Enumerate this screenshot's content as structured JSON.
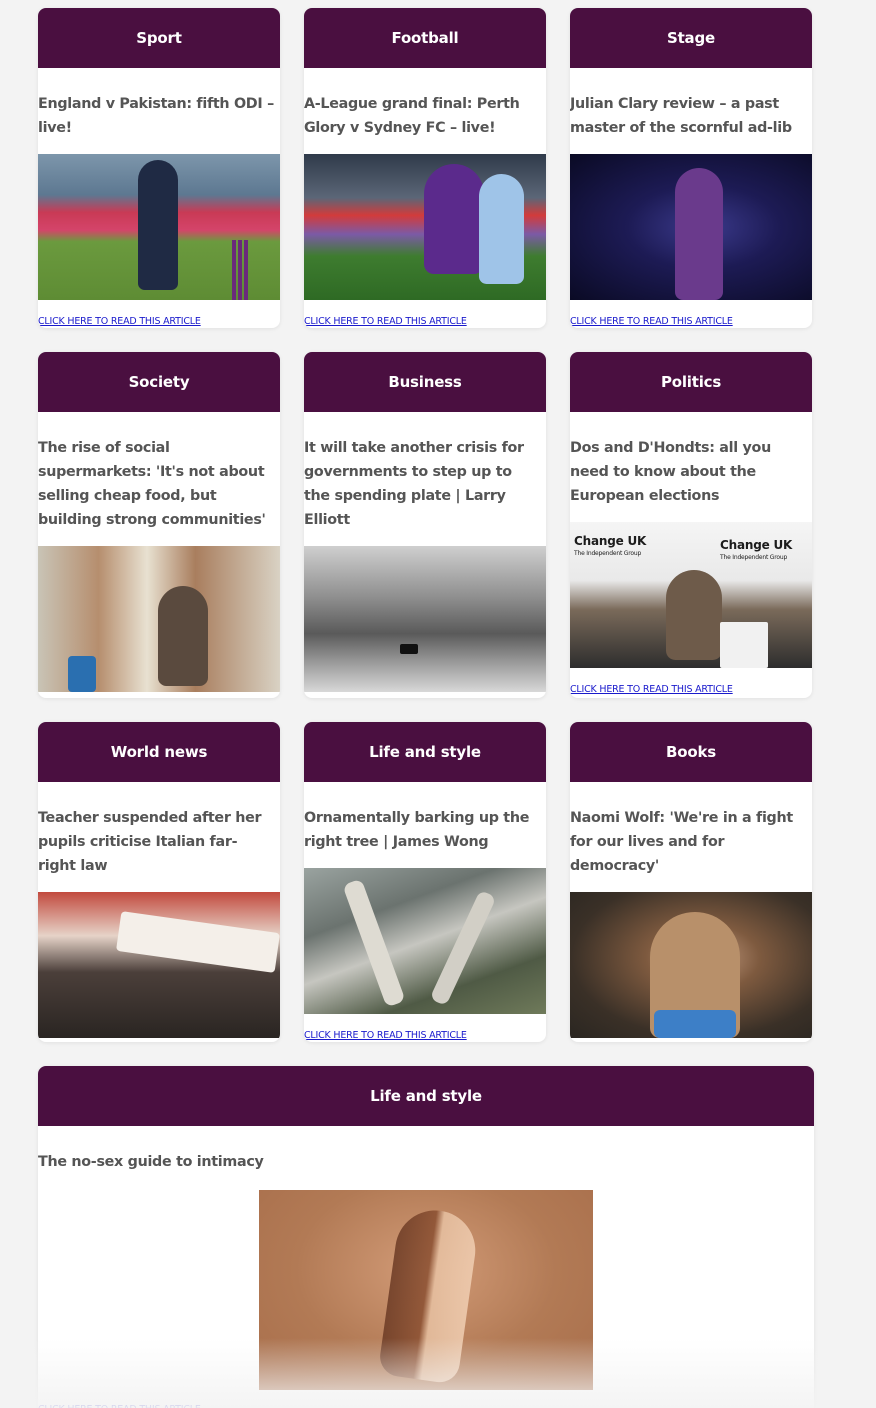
{
  "colors": {
    "header_bg": "#4a0f40",
    "header_text": "#ffffff",
    "title_text": "#555555",
    "link_text": "#1a1acc",
    "page_bg": "#f3f3f3"
  },
  "link_text": "CLICK HERE TO READ THIS ARTICLE",
  "cards": [
    {
      "category": "Sport",
      "title": "England v Pakistan: fifth ODI – live!",
      "image": "cricket-batsman-image"
    },
    {
      "category": "Football",
      "title": "A-League grand final: Perth Glory v Sydney FC – live!",
      "image": "football-players-image"
    },
    {
      "category": "Stage",
      "title": "Julian Clary review – a past master of the scornful ad-lib",
      "image": "stage-performer-image"
    },
    {
      "category": "Society",
      "title": "The rise of social supermarkets: 'It's not about selling cheap food, but building strong communities'",
      "image": "supermarket-aisle-image"
    },
    {
      "category": "Business",
      "title": "It will take another crisis for governments to step up to the spending plate | Larry Elliott",
      "image": "dust-storm-image"
    },
    {
      "category": "Politics",
      "title": "Dos and D'Hondts: all you need to know about the European elections",
      "image": "politician-podium-image",
      "overlay_left": "Change UK",
      "overlay_left_sub": "The Independent Group",
      "overlay_right": "Change UK",
      "overlay_right_sub": "The Independent Group"
    },
    {
      "category": "World news",
      "title": "Teacher suspended after her pupils criticise Italian far-right law",
      "image": "protest-crowd-image"
    },
    {
      "category": "Life and style",
      "title": "Ornamentally barking up the right tree | James Wong",
      "image": "gnarled-trees-image"
    },
    {
      "category": "Books",
      "title": "Naomi Wolf: 'We're in a fight for our lives and for democracy'",
      "image": "portrait-woman-image"
    },
    {
      "category": "Life and style",
      "title": "The no-sex guide to intimacy",
      "image": "touching-hands-image"
    }
  ]
}
